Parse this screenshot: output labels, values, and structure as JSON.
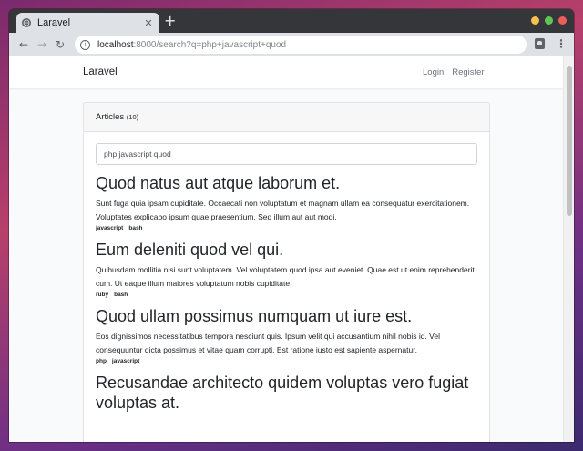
{
  "browser": {
    "tab_title": "Laravel",
    "new_tab": "+",
    "url_host": "localhost",
    "url_rest": ":8000/search?q=php+javascript+quod"
  },
  "site": {
    "brand": "Laravel",
    "nav": {
      "login": "Login",
      "register": "Register"
    }
  },
  "card": {
    "title": "Articles",
    "count": "(10)",
    "search_value": "php javascript quod"
  },
  "articles": [
    {
      "title": "Quod natus aut atque laborum et.",
      "body": "Sunt fuga quia ipsam cupiditate. Occaecati non voluptatum et magnam ullam ea consequatur exercitationem. Voluptates explicabo ipsum quae praesentium. Sed illum aut aut modi.",
      "tags": [
        "javascript",
        "bash"
      ]
    },
    {
      "title": "Eum deleniti quod vel qui.",
      "body": "Quibusdam mollitia nisi sunt voluptatem. Vel voluptatem quod ipsa aut eveniet. Quae est ut enim reprehenderit cum. Ut eaque illum maiores voluptatum nobis cupiditate.",
      "tags": [
        "ruby",
        "bash"
      ]
    },
    {
      "title": "Quod ullam possimus numquam ut iure est.",
      "body": "Eos dignissimos necessitatibus tempora nesciunt quis. Ipsum velit qui accusantium nihil nobis id. Vel consequuntur dicta possimus et vitae quam corrupti. Est ratione iusto est sapiente aspernatur.",
      "tags": [
        "php",
        "javascript"
      ]
    },
    {
      "title": "Recusandae architecto quidem voluptas vero fugiat voluptas at.",
      "body": "",
      "tags": []
    }
  ],
  "colors": {
    "traffic_yellow": "#f4bf4f",
    "traffic_green": "#61c554",
    "traffic_red": "#ed5e5a"
  }
}
